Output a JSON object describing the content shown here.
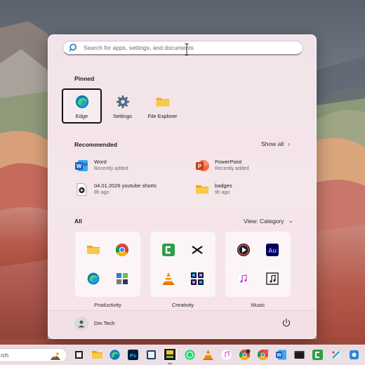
{
  "search": {
    "placeholder": "Search for apps, settings, and documents"
  },
  "pinned": {
    "label": "Pinned",
    "items": [
      {
        "label": "Edge",
        "icon": "edge-icon",
        "selected": true
      },
      {
        "label": "Settings",
        "icon": "gear-icon"
      },
      {
        "label": "File Explorer",
        "icon": "folder-icon"
      }
    ]
  },
  "recommended": {
    "label": "Recommended",
    "show_all": "Show all",
    "items": [
      {
        "title": "Word",
        "subtitle": "Recently added",
        "icon": "word-icon"
      },
      {
        "title": "PowerPoint",
        "subtitle": "Recently added",
        "icon": "powerpoint-icon"
      },
      {
        "title": "04.01.2026 youtube shorts",
        "subtitle": "8h ago",
        "icon": "video-file-icon"
      },
      {
        "title": "badges",
        "subtitle": "9h ago",
        "icon": "folder-icon"
      }
    ]
  },
  "all": {
    "label": "All",
    "view": "View: Category",
    "categories": [
      {
        "label": "Productivity",
        "icons": [
          "folder-icon",
          "chrome-icon",
          "edge-icon",
          "control-panel-icon"
        ]
      },
      {
        "label": "Creativity",
        "icons": [
          "camtasia-icon",
          "capcut-icon",
          "vlc-icon",
          "adobe-suite-icon"
        ]
      },
      {
        "label": "Music",
        "icons": [
          "media-player-icon",
          "audition-icon",
          "itunes-icon",
          "music-file-icon"
        ]
      }
    ]
  },
  "user": {
    "name": "Dm Tech"
  },
  "taskbar": {
    "search_text": "rch",
    "icons": [
      "widgets-fig-icon",
      "task-view-icon",
      "file-explorer-icon",
      "edge-icon",
      "photoshop-icon",
      "sticky-app-icon",
      "greenshot-icon",
      "whatsapp-icon",
      "vlc-icon",
      "itunes-icon",
      "chrome-dev-icon",
      "chrome-icon",
      "chrome-profile-icon",
      "word-icon",
      "terminal-icon",
      "camtasia-icon",
      "snip-icon",
      "app-icon"
    ]
  },
  "colors": {
    "accent": "#0078d4",
    "menu_bg": "#f6e7ec"
  }
}
